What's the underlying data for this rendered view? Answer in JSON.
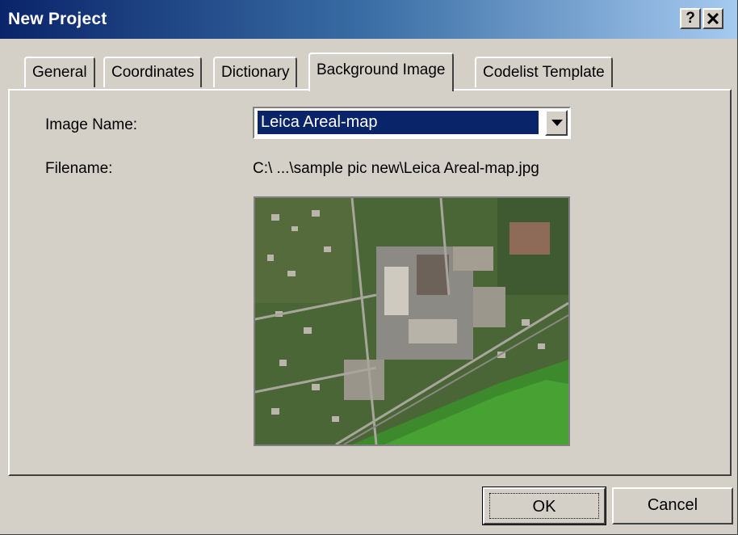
{
  "window": {
    "title": "New Project",
    "help_label": "?",
    "close_label": "✕"
  },
  "tabs": [
    {
      "label": "General",
      "active": false
    },
    {
      "label": "Coordinates",
      "active": false
    },
    {
      "label": "Dictionary",
      "active": false
    },
    {
      "label": "Background Image",
      "active": true
    },
    {
      "label": "Codelist Template",
      "active": false
    }
  ],
  "form": {
    "image_name_label": "Image Name:",
    "image_name_value": "Leica Areal-map",
    "filename_label": "Filename:",
    "filename_value": "C:\\ ...\\sample pic new\\Leica Areal-map.jpg"
  },
  "preview": {
    "icon": "aerial-map-image"
  },
  "buttons": {
    "ok_label": "OK",
    "cancel_label": "Cancel"
  }
}
